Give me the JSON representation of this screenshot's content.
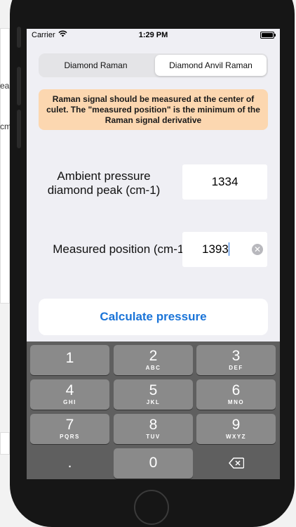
{
  "background_app": {
    "fragments": [
      "ea",
      "cm"
    ]
  },
  "status_bar": {
    "carrier": "Carrier",
    "time": "1:29 PM",
    "wifi_icon": "wifi-icon",
    "battery_icon": "battery-icon"
  },
  "segmented_control": {
    "segments": [
      {
        "label": "Diamond Raman",
        "selected": false
      },
      {
        "label": "Diamond Anvil Raman",
        "selected": true
      }
    ]
  },
  "warning": {
    "text": "Raman signal should be measured at the center of culet. The \"measured position\" is the minimum of the Raman signal derivative",
    "color": "#fcd7b0"
  },
  "fields": {
    "ambient": {
      "label": "Ambient pressure diamond peak (cm-1)",
      "value": "1334"
    },
    "measured": {
      "label": "Measured position (cm-1)",
      "value": "1393",
      "clear_icon": "clear-icon"
    }
  },
  "calculate_button": {
    "label": "Calculate pressure",
    "color": "#1a74d8"
  },
  "keyboard": {
    "keys": [
      {
        "digit": "1",
        "letters": ""
      },
      {
        "digit": "2",
        "letters": "ABC"
      },
      {
        "digit": "3",
        "letters": "DEF"
      },
      {
        "digit": "4",
        "letters": "GHI"
      },
      {
        "digit": "5",
        "letters": "JKL"
      },
      {
        "digit": "6",
        "letters": "MNO"
      },
      {
        "digit": "7",
        "letters": "PQRS"
      },
      {
        "digit": "8",
        "letters": "TUV"
      },
      {
        "digit": "9",
        "letters": "WXYZ"
      },
      {
        "digit": ".",
        "letters": ""
      },
      {
        "digit": "0",
        "letters": ""
      },
      {
        "digit": "⌫",
        "letters": ""
      }
    ],
    "delete_icon": "backspace-icon"
  }
}
